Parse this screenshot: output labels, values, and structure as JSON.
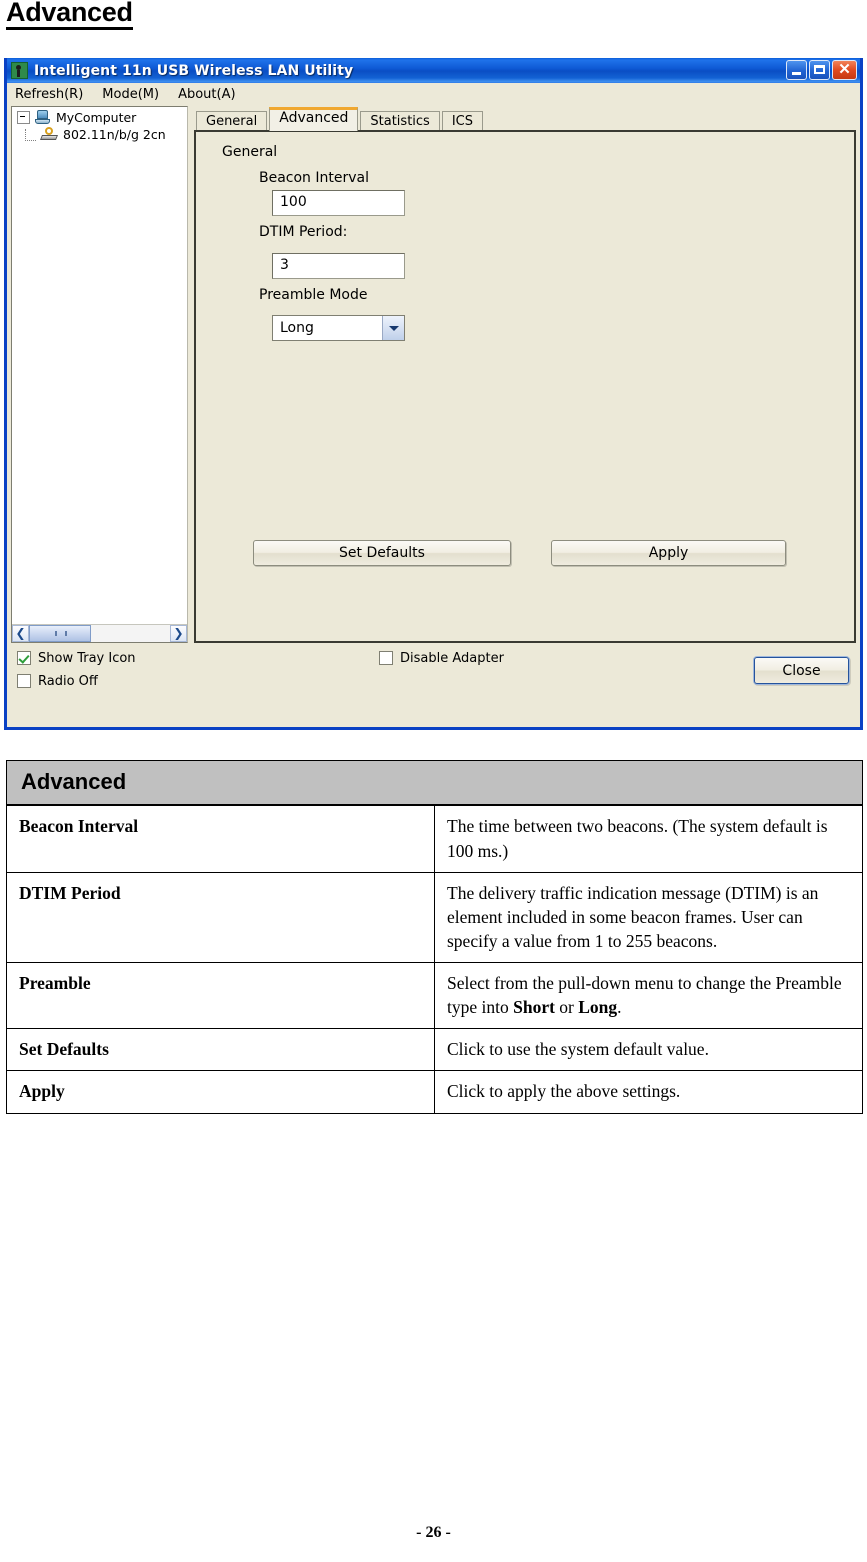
{
  "page": {
    "heading": "Advanced",
    "footer": "- 26 -"
  },
  "window": {
    "title": "Intelligent 11n USB Wireless LAN Utility",
    "controls": {
      "minimize": "_",
      "maximize": "□",
      "close": "✕"
    },
    "menu": [
      {
        "label": "Refresh(R)"
      },
      {
        "label": "Mode(M)"
      },
      {
        "label": "About(A)"
      }
    ],
    "tree": {
      "root": "MyComputer",
      "child": "802.11n/b/g 2cn"
    },
    "tabs": [
      {
        "label": "General",
        "active": false
      },
      {
        "label": "Advanced",
        "active": true
      },
      {
        "label": "Statistics",
        "active": false
      },
      {
        "label": "ICS",
        "active": false
      }
    ],
    "panel": {
      "group_label": "General",
      "beacon_interval": {
        "label": "Beacon Interval",
        "value": "100"
      },
      "dtim_period": {
        "label": "DTIM Period:",
        "value": "3"
      },
      "preamble_mode": {
        "label": "Preamble Mode",
        "value": "Long",
        "options": [
          "Long",
          "Short"
        ]
      },
      "buttons": {
        "set_defaults": "Set Defaults",
        "apply": "Apply"
      }
    },
    "footer": {
      "show_tray_icon": {
        "label": "Show Tray Icon",
        "checked": true
      },
      "radio_off": {
        "label": "Radio Off",
        "checked": false
      },
      "disable_adapter": {
        "label": "Disable Adapter",
        "checked": false
      },
      "close_button": "Close"
    }
  },
  "doc_table": {
    "header": "Advanced",
    "rows": [
      {
        "term": "Beacon Interval",
        "description": "The time between two beacons. (The system default is 100 ms.)"
      },
      {
        "term": "DTIM Period",
        "description": "The delivery traffic indication message (DTIM) is an element included in some beacon frames. User can specify a value from 1 to 255 beacons."
      },
      {
        "term": "Preamble",
        "description_prefix": "Select from the pull-down menu to change the Preamble type into ",
        "description_bold1": "Short",
        "description_mid": " or ",
        "description_bold2": "Long",
        "description_suffix": "."
      },
      {
        "term": "Set Defaults",
        "description": "Click to use the system default value."
      },
      {
        "term": "Apply",
        "description": "Click to apply the above settings."
      }
    ]
  }
}
